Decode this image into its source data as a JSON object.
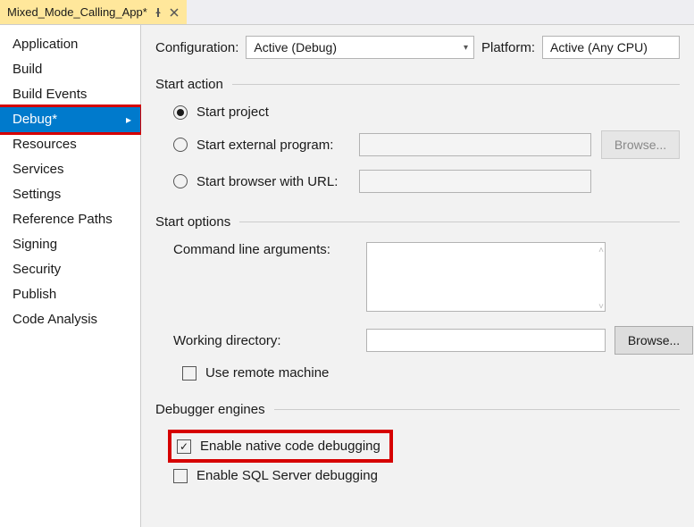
{
  "tab": {
    "title": "Mixed_Mode_Calling_App*"
  },
  "config": {
    "label": "Configuration:",
    "value": "Active (Debug)"
  },
  "platform": {
    "label": "Platform:",
    "value": "Active (Any CPU)"
  },
  "sidebar": {
    "items": [
      {
        "label": "Application"
      },
      {
        "label": "Build"
      },
      {
        "label": "Build Events"
      },
      {
        "label": "Debug*"
      },
      {
        "label": "Resources"
      },
      {
        "label": "Services"
      },
      {
        "label": "Settings"
      },
      {
        "label": "Reference Paths"
      },
      {
        "label": "Signing"
      },
      {
        "label": "Security"
      },
      {
        "label": "Publish"
      },
      {
        "label": "Code Analysis"
      }
    ]
  },
  "sections": {
    "startAction": {
      "title": "Start action",
      "startProject": "Start project",
      "startExternal": "Start external program:",
      "startBrowser": "Start browser with URL:",
      "browse": "Browse..."
    },
    "startOptions": {
      "title": "Start options",
      "cmdArgsLabel": "Command line arguments:",
      "workDirLabel": "Working directory:",
      "remoteLabel": "Use remote machine",
      "browse": "Browse..."
    },
    "debuggerEngines": {
      "title": "Debugger engines",
      "nativeLabel": "Enable native code debugging",
      "sqlLabel": "Enable SQL Server debugging"
    }
  }
}
